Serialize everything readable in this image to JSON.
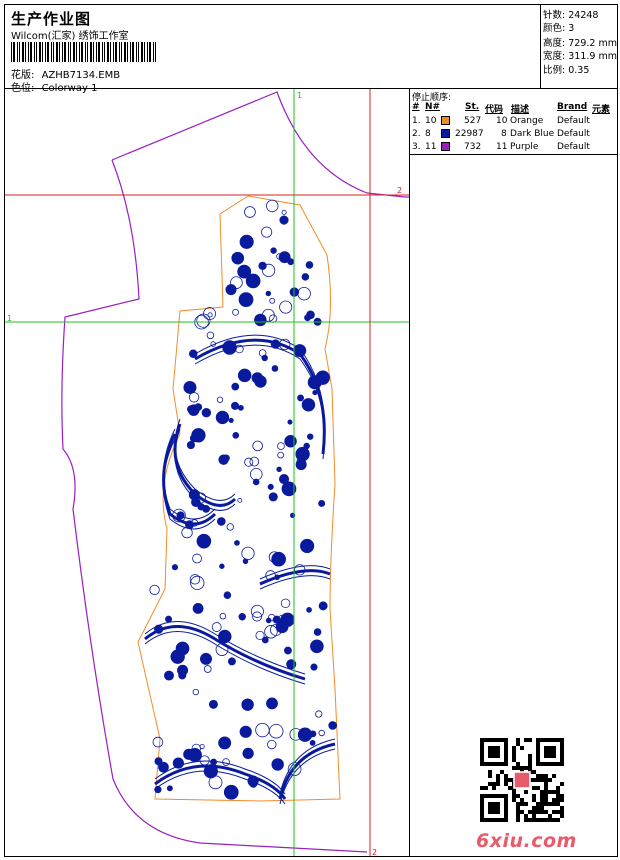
{
  "header": {
    "title": "生产作业图",
    "company": "Wilcom(汇家) 绣饰工作室",
    "design_label": "花版:",
    "design_value": "AZHB7134.EMB",
    "colorway_label": "色位:",
    "colorway_value": "Colorway 1"
  },
  "stats": [
    {
      "label": "针数:",
      "value": "24248"
    },
    {
      "label": "颜色:",
      "value": "3"
    },
    {
      "label": "高度:",
      "value": "729.2 mm"
    },
    {
      "label": "宽度:",
      "value": "311.9 mm"
    },
    {
      "label": "比例:",
      "value": "0.35"
    }
  ],
  "stops": {
    "title": "停止顺序:",
    "columns": [
      "#",
      "N#",
      "St.",
      "代码",
      "描述",
      "Brand",
      "元素"
    ],
    "rows": [
      {
        "index": "1.",
        "needle": "10",
        "color": "#f28c28",
        "stitches": "527",
        "code": "10",
        "desc": "Orange",
        "brand": "Default"
      },
      {
        "index": "2.",
        "needle": "8",
        "color": "#0a1a9c",
        "stitches": "22987",
        "code": "8",
        "desc": "Dark Blue",
        "brand": "Default"
      },
      {
        "index": "3.",
        "needle": "11",
        "color": "#9a1fbf",
        "stitches": "732",
        "code": "11",
        "desc": "Purple",
        "brand": "Default"
      }
    ]
  },
  "guides": {
    "v1": "1",
    "h1": "1",
    "h2": "2",
    "v2": "2"
  },
  "watermark": "6xiu.com",
  "colors": {
    "pattern_outline": "#9a1fbf",
    "embroidery": "#0a1a9c",
    "border": "#f28c28",
    "guide_green": "#22c022",
    "guide_red": "#d62020"
  }
}
